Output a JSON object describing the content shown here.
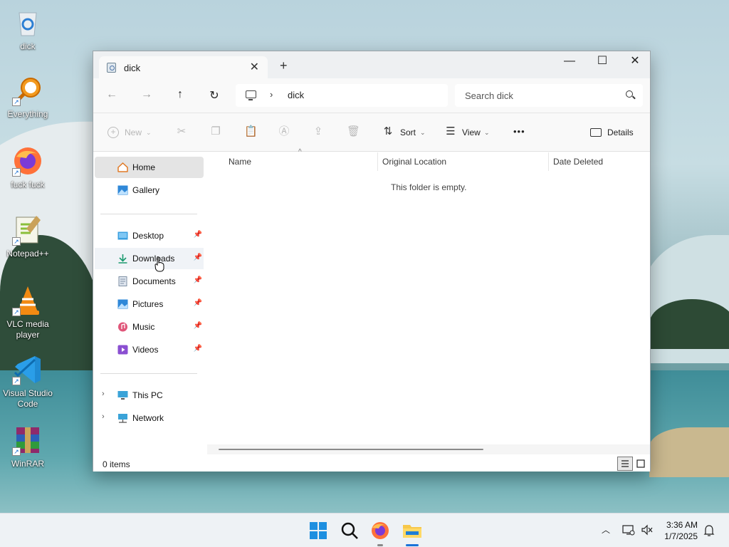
{
  "desktop": {
    "icons": [
      {
        "label": "dick",
        "icon": "recycle-bin-icon"
      },
      {
        "label": "Everything",
        "icon": "everything-search-icon"
      },
      {
        "label": "fuck fuck",
        "icon": "firefox-icon"
      },
      {
        "label": "Notepad++",
        "icon": "notepad-plus-plus-icon"
      },
      {
        "label": "VLC media player",
        "icon": "vlc-icon"
      },
      {
        "label": "Visual Studio Code",
        "icon": "vscode-icon"
      },
      {
        "label": "WinRAR",
        "icon": "winrar-icon"
      }
    ]
  },
  "window": {
    "tab_title": "dick",
    "tab_close": "✕",
    "new_tab": "+",
    "controls": {
      "minimize": "—",
      "maximize": "☐",
      "close": "✕"
    }
  },
  "navbar": {
    "back": "←",
    "forward": "→",
    "up": "↑",
    "refresh": "↻",
    "breadcrumb_sep": "›",
    "breadcrumb": "dick",
    "search_placeholder": "Search dick"
  },
  "toolbar": {
    "new_label": "New",
    "sort_label": "Sort",
    "view_label": "View",
    "more_label": "•••",
    "details_label": "Details"
  },
  "nav_pane": {
    "items": [
      {
        "label": "Home",
        "icon": "home-icon",
        "pinned": false
      },
      {
        "label": "Gallery",
        "icon": "gallery-icon",
        "pinned": false
      },
      {
        "label": "Desktop",
        "icon": "desktop-folder-icon",
        "pinned": true
      },
      {
        "label": "Downloads",
        "icon": "downloads-icon",
        "pinned": true
      },
      {
        "label": "Documents",
        "icon": "documents-icon",
        "pinned": true
      },
      {
        "label": "Pictures",
        "icon": "pictures-icon",
        "pinned": true
      },
      {
        "label": "Music",
        "icon": "music-icon",
        "pinned": true
      },
      {
        "label": "Videos",
        "icon": "videos-icon",
        "pinned": true
      },
      {
        "label": "This PC",
        "icon": "this-pc-icon",
        "pinned": false
      },
      {
        "label": "Network",
        "icon": "network-icon",
        "pinned": false
      }
    ],
    "selected": "Home",
    "hovered": "Downloads"
  },
  "content": {
    "columns": [
      "Name",
      "Original Location",
      "Date Deleted"
    ],
    "empty_message": "This folder is empty."
  },
  "statusbar": {
    "item_count": "0 items"
  },
  "taskbar": {
    "apps": [
      "start-icon",
      "search-icon",
      "firefox-icon",
      "file-explorer-icon"
    ],
    "time": "3:36 AM",
    "date": "1/7/2025"
  }
}
